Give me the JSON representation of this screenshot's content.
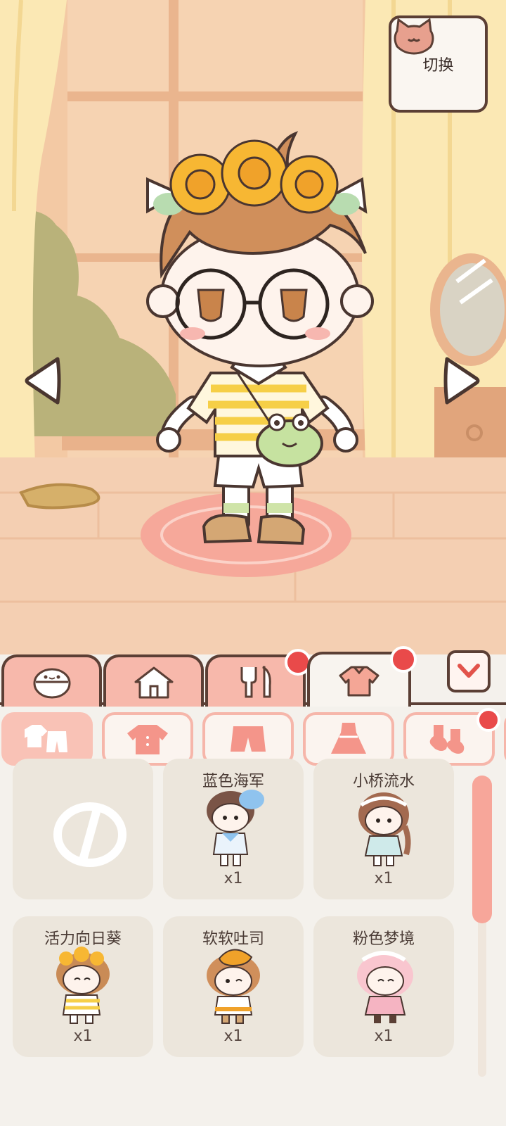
{
  "top_right_button": {
    "label": "切换",
    "icon": "cat-head-icon"
  },
  "navigation": {
    "prev_icon": "left-arrow-icon",
    "next_icon": "right-arrow-icon"
  },
  "main_tabs": [
    {
      "icon": "face-icon",
      "active": false,
      "badge": false
    },
    {
      "icon": "house-icon",
      "active": false,
      "badge": false
    },
    {
      "icon": "fork-knife-icon",
      "active": false,
      "badge": true
    },
    {
      "icon": "shirt-icon",
      "active": true,
      "badge": true
    }
  ],
  "collapse_icon": "chevron-down-icon",
  "category_chips": [
    {
      "icon": "all-clothes-icon",
      "active": true,
      "badge": false
    },
    {
      "icon": "top-shirt-icon",
      "active": false,
      "badge": false
    },
    {
      "icon": "shorts-icon",
      "active": false,
      "badge": false
    },
    {
      "icon": "dress-icon",
      "active": false,
      "badge": false
    },
    {
      "icon": "socks-icon",
      "active": false,
      "badge": true
    }
  ],
  "items": [
    {
      "name": "",
      "qty": "",
      "icon": "none-icon"
    },
    {
      "name": "蓝色海军",
      "qty": "x1",
      "icon": "outfit-blue-navy-icon"
    },
    {
      "name": "小桥流水",
      "qty": "x1",
      "icon": "outfit-bridge-stream-icon"
    },
    {
      "name": "活力向日葵",
      "qty": "x1",
      "icon": "outfit-sunflower-icon"
    },
    {
      "name": "软软吐司",
      "qty": "x1",
      "icon": "outfit-soft-toast-icon"
    },
    {
      "name": "粉色梦境",
      "qty": "x1",
      "icon": "outfit-pink-dream-icon"
    }
  ],
  "colors": {
    "outline": "#5b3f35",
    "tab_pink": "#f7b8ab",
    "badge_red": "#e94a4a",
    "scroll": "#f7a69a"
  }
}
